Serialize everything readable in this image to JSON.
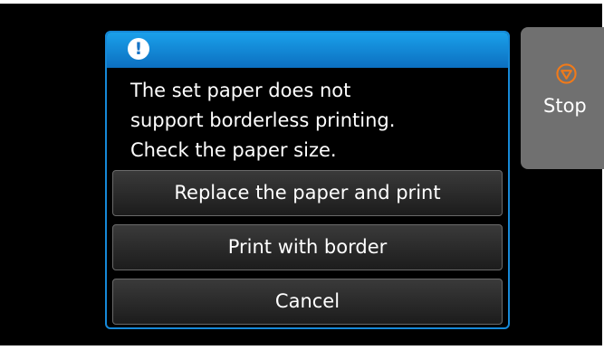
{
  "dialog": {
    "icon": "exclamation-alert-icon",
    "icon_glyph": "!",
    "message_lines": [
      "The set paper does not",
      "support borderless printing.",
      "Check the paper size."
    ],
    "options": [
      "Replace the paper and print",
      "Print with border",
      "Cancel"
    ]
  },
  "stop": {
    "label": "Stop",
    "icon": "stop-icon"
  },
  "colors": {
    "header_blue": "#1689d8",
    "stop_orange": "#f07a1a",
    "stop_panel": "#707070",
    "background": "#000000"
  }
}
